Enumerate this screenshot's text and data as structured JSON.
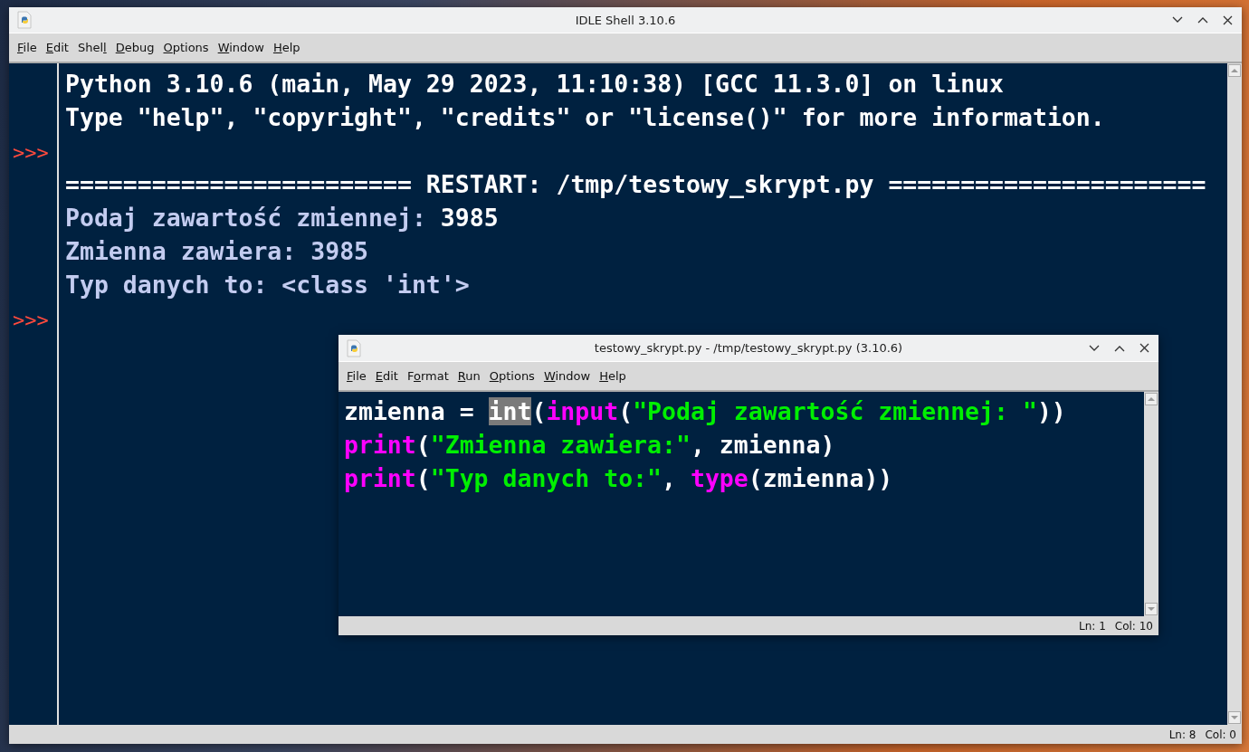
{
  "shell_window": {
    "title": "IDLE Shell 3.10.6",
    "menu": [
      {
        "key": "F",
        "post": "ile"
      },
      {
        "key": "E",
        "post": "dit"
      },
      {
        "pre": "Shel",
        "key": "l"
      },
      {
        "key": "D",
        "post": "ebug"
      },
      {
        "key": "O",
        "post": "ptions"
      },
      {
        "key": "W",
        "post": "indow"
      },
      {
        "key": "H",
        "post": "elp"
      }
    ],
    "lines": [
      {
        "segments": [
          {
            "kind": "plain",
            "text": "Python 3.10.6 (main, May 29 2023, 11:10:38) [GCC 11.3.0] on linux"
          }
        ]
      },
      {
        "segments": [
          {
            "kind": "plain",
            "text": "Type \"help\", \"copyright\", \"credits\" or \"license()\" for more information."
          }
        ]
      },
      {
        "prompt": ">>>"
      },
      {
        "segments": [
          {
            "kind": "plain",
            "text": "======================== RESTART: /tmp/testowy_skrypt.py ======================"
          }
        ]
      },
      {
        "segments": [
          {
            "kind": "stdout",
            "text": "Podaj zawartość zmiennej: "
          },
          {
            "kind": "plain",
            "text": "3985"
          }
        ]
      },
      {
        "segments": [
          {
            "kind": "stdout",
            "text": "Zmienna zawiera: 3985"
          }
        ]
      },
      {
        "segments": [
          {
            "kind": "stdout",
            "text": "Typ danych to: <class 'int'>"
          }
        ]
      },
      {
        "prompt": ">>>"
      }
    ],
    "status_bar": {
      "line": "Ln: 8",
      "column": "Col: 0"
    }
  },
  "editor_window": {
    "title": "testowy_skrypt.py - /tmp/testowy_skrypt.py (3.10.6)",
    "menu": [
      {
        "key": "F",
        "post": "ile"
      },
      {
        "key": "E",
        "post": "dit"
      },
      {
        "pre": "F",
        "key": "o",
        "post": "rmat"
      },
      {
        "key": "R",
        "post": "un"
      },
      {
        "key": "O",
        "post": "ptions"
      },
      {
        "key": "W",
        "post": "indow"
      },
      {
        "key": "H",
        "post": "elp"
      }
    ],
    "lines": [
      {
        "segments": [
          {
            "kind": "plain",
            "text": "zmienna = "
          },
          {
            "kind": "selected",
            "text": "int"
          },
          {
            "kind": "plain",
            "text": "("
          },
          {
            "kind": "builtin",
            "text": "input"
          },
          {
            "kind": "plain",
            "text": "("
          },
          {
            "kind": "string",
            "text": "\"Podaj zawartość zmiennej: \""
          },
          {
            "kind": "plain",
            "text": "))"
          }
        ]
      },
      {
        "segments": [
          {
            "kind": "builtin",
            "text": "print"
          },
          {
            "kind": "plain",
            "text": "("
          },
          {
            "kind": "string",
            "text": "\"Zmienna zawiera:\""
          },
          {
            "kind": "plain",
            "text": ", zmienna)"
          }
        ]
      },
      {
        "segments": [
          {
            "kind": "builtin",
            "text": "print"
          },
          {
            "kind": "plain",
            "text": "("
          },
          {
            "kind": "string",
            "text": "\"Typ danych to:\""
          },
          {
            "kind": "plain",
            "text": ", "
          },
          {
            "kind": "builtin",
            "text": "type"
          },
          {
            "kind": "plain",
            "text": "(zmienna))"
          }
        ]
      }
    ],
    "status_bar": {
      "line": "Ln: 1",
      "column": "Col: 10"
    }
  }
}
